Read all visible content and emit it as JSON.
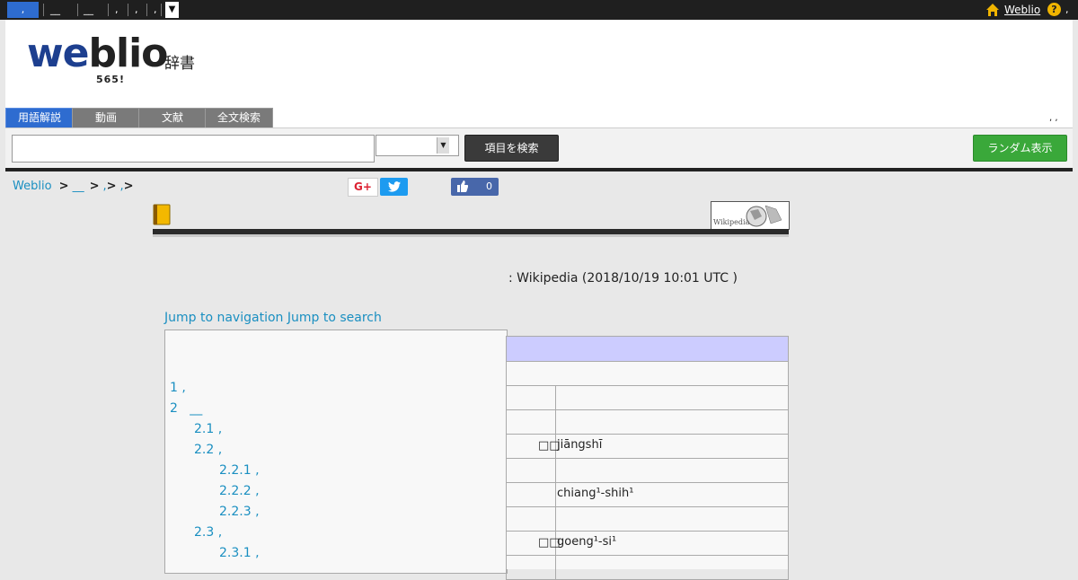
{
  "topbar": {
    "items": [
      ",",
      "__",
      "__",
      ",",
      ",",
      ","
    ],
    "dropdown": "▼",
    "user_link": "Weblio",
    "help": "?",
    "tail": ","
  },
  "header": {
    "logo_w": "we",
    "logo_rest": "blio",
    "logo_jisho": "辞書",
    "count": "565!",
    "tabs": [
      "用語解説",
      "動画",
      "文献",
      "全文検索"
    ],
    "right_text": ",  ,"
  },
  "search": {
    "placeholder": "",
    "search_button": "項目を検索",
    "random_button": "ランダム表示"
  },
  "breadcrumb": {
    "items": [
      "Weblio ",
      ">",
      "__",
      ">",
      ",",
      ">",
      ",",
      ">"
    ]
  },
  "social": {
    "gplus": "G+",
    "tweet": "t",
    "fb_count": "0"
  },
  "article": {
    "wiki_label": "Wikipedia",
    "source": ": Wikipedia (2018/10/19 10:01 UTC )",
    "jump_nav": "Jump to navigation",
    "jump_search": "Jump to search"
  },
  "toc": [
    {
      "text": "1 ,",
      "level": 0
    },
    {
      "text": "2   __",
      "level": 0
    },
    {
      "text": "2.1 ,",
      "level": 1
    },
    {
      "text": "2.2 ,",
      "level": 1
    },
    {
      "text": "2.2.1 ,",
      "level": 2
    },
    {
      "text": "2.2.2 ,",
      "level": 2
    },
    {
      "text": "2.2.3 ,",
      "level": 2
    },
    {
      "text": "2.3 ,",
      "level": 1
    },
    {
      "text": "2.3.1 ,",
      "level": 2
    }
  ],
  "infobox": {
    "rows": [
      {
        "k": "",
        "v": "",
        "full": true
      },
      {
        "k": "",
        "v": ""
      },
      {
        "k": "",
        "v": ""
      },
      {
        "k": "□□",
        "v": "jiāngshī"
      },
      {
        "k": "",
        "v": ""
      },
      {
        "k": "",
        "v": "chiang¹-shih¹"
      },
      {
        "k": "",
        "v": ""
      },
      {
        "k": "□□",
        "v": "goeng¹-si¹"
      },
      {
        "k": "",
        "v": ""
      }
    ]
  }
}
